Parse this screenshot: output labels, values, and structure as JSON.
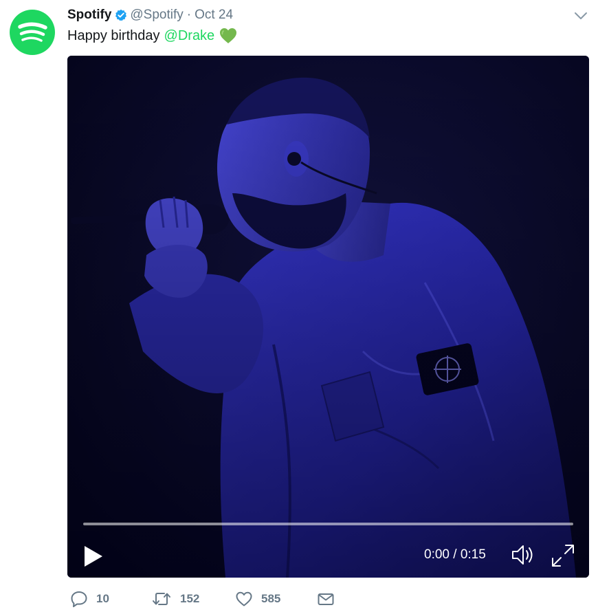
{
  "tweet": {
    "display_name": "Spotify",
    "verified": true,
    "handle": "@Spotify",
    "separator": "·",
    "timestamp": "Oct 24",
    "text_prefix": "Happy birthday",
    "mention": "@Drake",
    "emoji": "green-heart-emoji"
  },
  "video": {
    "time_display": "0:00 / 0:15",
    "progress": 0,
    "tint": "#2b2bc4"
  },
  "actions": {
    "reply_count": "10",
    "retweet_count": "152",
    "like_count": "585"
  },
  "colors": {
    "brand_green": "#1ed760",
    "muted": "#657786",
    "verified_blue": "#1da1f2"
  },
  "icons": {
    "avatar": "spotify-logo-icon",
    "verified": "verified-badge-icon",
    "caret": "chevron-down-icon",
    "play": "play-icon",
    "volume": "volume-icon",
    "fullscreen": "fullscreen-icon",
    "reply": "reply-icon",
    "retweet": "retweet-icon",
    "like": "heart-icon",
    "dm": "envelope-icon"
  }
}
